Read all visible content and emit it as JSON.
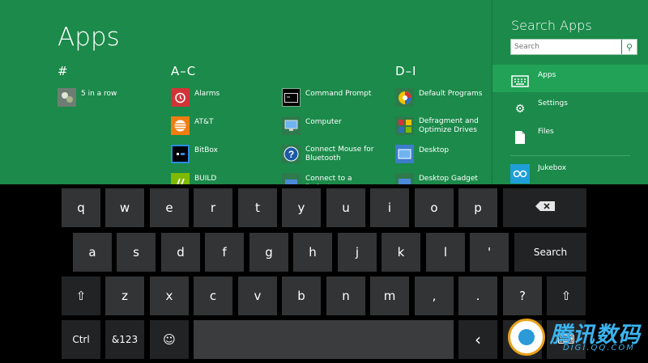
{
  "apps_view": {
    "title": "Apps",
    "groups": [
      {
        "header": "#"
      },
      {
        "header": "A–C"
      },
      {
        "header": "D–I"
      }
    ],
    "items": [
      {
        "label": "5 in a row",
        "icon": "five-in-a-row-icon",
        "color": "#6e7d73"
      },
      {
        "label": "Alarms",
        "icon": "alarm-clock-icon",
        "color": "#d13438"
      },
      {
        "label": "AT&T",
        "icon": "att-globe-icon",
        "color": "#f07d10"
      },
      {
        "label": "BitBox",
        "icon": "bitbox-icon",
        "color": "#000000"
      },
      {
        "label": "BUILD",
        "icon": "build-icon",
        "color": "#7fba00"
      },
      {
        "label": "Command Prompt",
        "icon": "command-prompt-icon",
        "color": "#000000"
      },
      {
        "label": "Computer",
        "icon": "computer-icon",
        "color": "#2d6cc0"
      },
      {
        "label": "Connect Mouse for Bluetooth",
        "icon": "help-icon",
        "color": "#1c5aa8"
      },
      {
        "label": "Connect to a Projector",
        "icon": "projector-icon",
        "color": "#2d6cc0"
      },
      {
        "label": "Default Programs",
        "icon": "default-programs-icon",
        "color": "#3a9b3a"
      },
      {
        "label": "Defragment and Optimize Drives",
        "icon": "defragment-icon",
        "color": "#8a5bb5"
      },
      {
        "label": "Desktop",
        "icon": "desktop-icon",
        "color": "#3d7cc9"
      },
      {
        "label": "Desktop Gadget",
        "icon": "desktop-gadget-icon",
        "color": "#4a8ad8"
      }
    ]
  },
  "charm": {
    "title": "Search Apps",
    "search": {
      "value": "",
      "placeholder": "Search"
    },
    "scopes": [
      {
        "label": "Apps",
        "icon": "keyboard-icon"
      },
      {
        "label": "Settings",
        "icon": "gear-icon"
      },
      {
        "label": "Files",
        "icon": "document-icon"
      }
    ],
    "apps": [
      {
        "label": "Jukebox",
        "icon": "jukebox-icon"
      }
    ]
  },
  "keyboard": {
    "row1": [
      "q",
      "w",
      "e",
      "r",
      "t",
      "y",
      "u",
      "i",
      "o",
      "p",
      "⌫"
    ],
    "row2": [
      "a",
      "s",
      "d",
      "f",
      "g",
      "h",
      "j",
      "k",
      "l",
      "'",
      "Search"
    ],
    "row3": [
      "⇧",
      "z",
      "x",
      "c",
      "v",
      "b",
      "n",
      "m",
      ",",
      ".",
      "?",
      "⇧"
    ],
    "row4": [
      "Ctrl",
      "&123",
      "☺",
      "",
      "‹",
      "›",
      "⌨"
    ]
  },
  "watermark": {
    "brand": "腾讯数码",
    "url": "DIGI.QQ.COM"
  }
}
